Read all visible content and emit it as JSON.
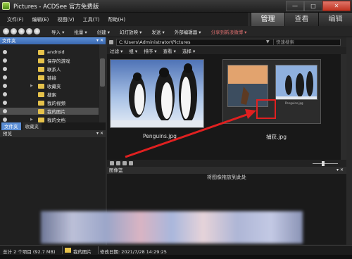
{
  "window": {
    "title": "Pictures - ACDSee 官方免费版",
    "close_glyph": "✕",
    "max_glyph": "□",
    "min_glyph": "—"
  },
  "menu": [
    "文件(F)",
    "编辑(E)",
    "视图(V)",
    "工具(T)",
    "帮助(H)"
  ],
  "modes": [
    "管理",
    "查看",
    "编辑"
  ],
  "toolbar": [
    "导入 ▾",
    "批量 ▾",
    "创建 ▾",
    "幻灯放映 ▾",
    "发送 ▾",
    "外部编辑器 ▾",
    "分享到新浪微博 ▾"
  ],
  "folders_panel": {
    "title": "文件夹",
    "pin": "▾ ✕",
    "items": [
      "android",
      "保存的游戏",
      "联系人",
      "链接",
      "收藏夹",
      "搜索",
      "我的视频",
      "我的图片",
      "我的文档"
    ],
    "selected_index": 7
  },
  "left_tabs": [
    "文件夹",
    "收藏夹"
  ],
  "preview_panel": {
    "title": "预览",
    "pin": "▾ ✕"
  },
  "address": {
    "path": "C:\\Users\\Administrator\\Pictures",
    "search_placeholder": "快速搜索"
  },
  "filterbar": [
    "过滤 ▾",
    "组 ▾",
    "排序 ▾",
    "查看 ▾",
    "选择 ▾"
  ],
  "thumbnails": [
    {
      "caption": "Penguins.jpg"
    },
    {
      "caption": "捕获.jpg",
      "inner": [
        "",
        "Penguins.jpg"
      ]
    }
  ],
  "basket": {
    "title": "图像篮",
    "message": "将图像拖放到此处",
    "pin": "▾ ✕"
  },
  "status": {
    "total": "总计 2 个项目 (92.7 MB)",
    "folder": "我的图片",
    "modified": "修改日期: 2021/7/28 14:29:25"
  },
  "colors": {
    "accent": "#5b8ed5",
    "highlight": "#e02020",
    "folder": "#e6c24b"
  }
}
